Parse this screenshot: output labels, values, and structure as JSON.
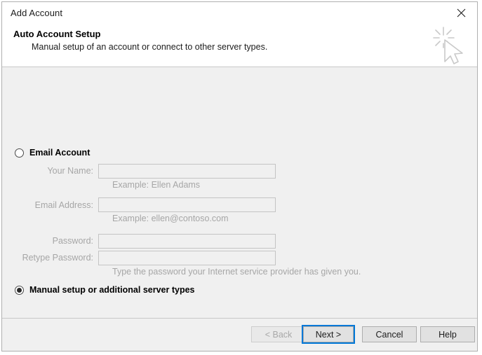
{
  "window": {
    "title": "Add Account",
    "close_icon": "close-icon"
  },
  "header": {
    "title": "Auto Account Setup",
    "subtitle": "Manual setup of an account or connect to other server types.",
    "icon": "cursor-sparkle-icon"
  },
  "options": {
    "email_account": {
      "label": "Email Account",
      "selected": false
    },
    "manual_setup": {
      "label": "Manual setup or additional server types",
      "selected": true
    }
  },
  "form": {
    "enabled": false,
    "fields": [
      {
        "label": "Your Name:",
        "value": "",
        "placeholder": ""
      },
      {
        "label": "Email Address:",
        "value": "",
        "placeholder": ""
      },
      {
        "label": "Password:",
        "value": "",
        "placeholder": ""
      },
      {
        "label": "Retype Password:",
        "value": "",
        "placeholder": ""
      }
    ],
    "hints": {
      "name_example": "Example: Ellen Adams",
      "email_example": "Example: ellen@contoso.com",
      "password_note": "Type the password your Internet service provider has given you."
    }
  },
  "footer": {
    "back_label": "< Back",
    "next_label": "Next >",
    "cancel_label": "Cancel",
    "help_label": "Help"
  },
  "colors": {
    "accent": "#0078d7",
    "dialog_bg": "#f0f0f0",
    "header_bg": "#ffffff",
    "disabled_text": "#a6a6a6"
  }
}
